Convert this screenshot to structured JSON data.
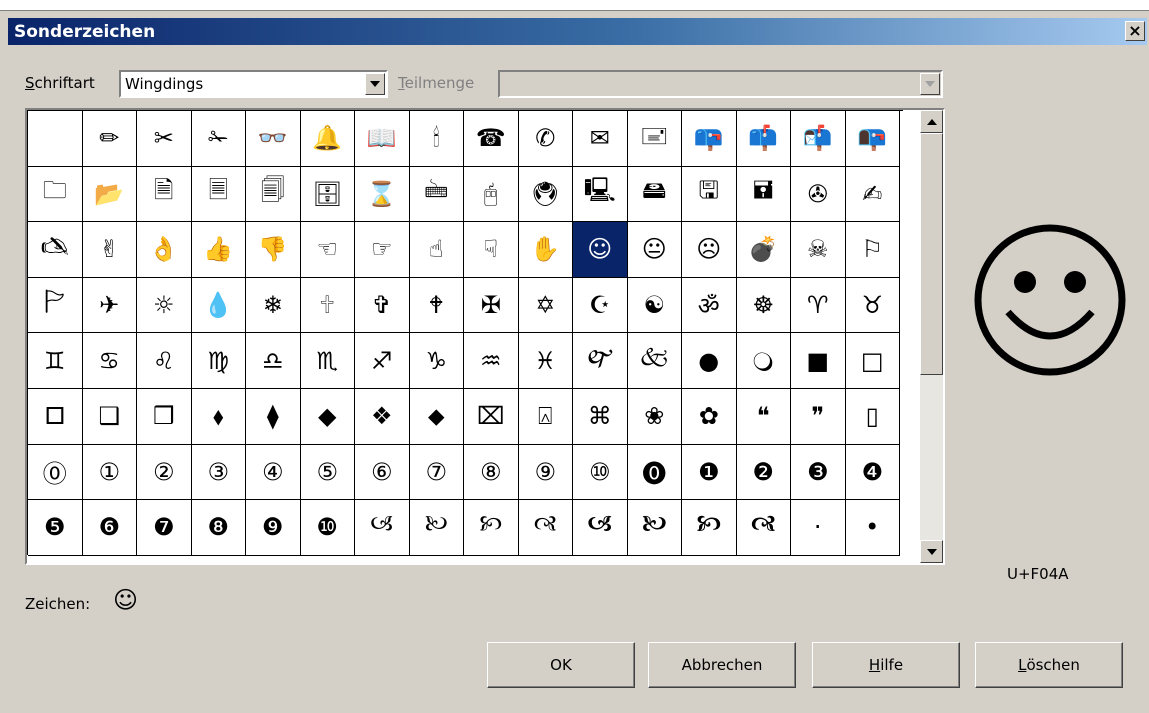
{
  "window": {
    "title": "Sonderzeichen",
    "close_label": "×"
  },
  "toolbar": {
    "font_label_accel": "S",
    "font_label_rest": "chriftart",
    "font_value": "Wingdings",
    "subset_label_accel": "T",
    "subset_label_rest": "eilmenge",
    "subset_value": ""
  },
  "grid": {
    "rows": [
      [
        "",
        "✏",
        "✂",
        "✁",
        "👓",
        "🔔",
        "📖",
        "🕯",
        "☎",
        "✆",
        "✉",
        "🖃",
        "📪",
        "📫",
        "📬",
        "📭"
      ],
      [
        "🗀",
        "📂",
        "🗎",
        "🗏",
        "🗐",
        "🗄",
        "⌛",
        "🖮",
        "🖰",
        "🖲",
        "🖳",
        "🖴",
        "🖫",
        "🖬",
        "✇",
        "✍"
      ],
      [
        "🖎",
        "✌",
        "👌",
        "👍",
        "👎",
        "☜",
        "☞",
        "☝",
        "☟",
        "✋",
        "☺",
        "😐",
        "☹",
        "💣",
        "☠",
        "⚐"
      ],
      [
        "🏱",
        "✈",
        "☼",
        "💧",
        "❄",
        "🕆",
        "✞",
        "🕈",
        "✠",
        "✡",
        "☪",
        "☯",
        "ॐ",
        "☸",
        "♈",
        "♉"
      ],
      [
        "♊",
        "♋",
        "♌",
        "♍",
        "♎",
        "♏",
        "♐",
        "♑",
        "♒",
        "♓",
        "🙰",
        "🙵",
        "●",
        "🔾",
        "■",
        "□"
      ],
      [
        "🞐",
        "❑",
        "❒",
        "⬧",
        "⧫",
        "◆",
        "❖",
        "⬥",
        "⌧",
        "⍓",
        "⌘",
        "❀",
        "✿",
        "❝",
        "❞",
        "▯"
      ],
      [
        "⓪",
        "①",
        "②",
        "③",
        "④",
        "⑤",
        "⑥",
        "⑦",
        "⑧",
        "⑨",
        "⑩",
        "⓿",
        "❶",
        "❷",
        "❸",
        "❹"
      ],
      [
        "❺",
        "❻",
        "❼",
        "❽",
        "❾",
        "❿",
        "🙢",
        "🙠",
        "🙡",
        "🙣",
        "🙦",
        "🙤",
        "🙥",
        "🙧",
        "·",
        "•"
      ]
    ],
    "selected_row": 2,
    "selected_col": 10
  },
  "preview": {
    "glyph": "☺",
    "code": "U+F04A"
  },
  "footer": {
    "char_label": "Zeichen:",
    "char_value": "☺"
  },
  "buttons": {
    "ok": "OK",
    "cancel": "Abbrechen",
    "help_accel": "H",
    "help_rest": "ilfe",
    "delete_accel": "L",
    "delete_rest": "öschen"
  }
}
